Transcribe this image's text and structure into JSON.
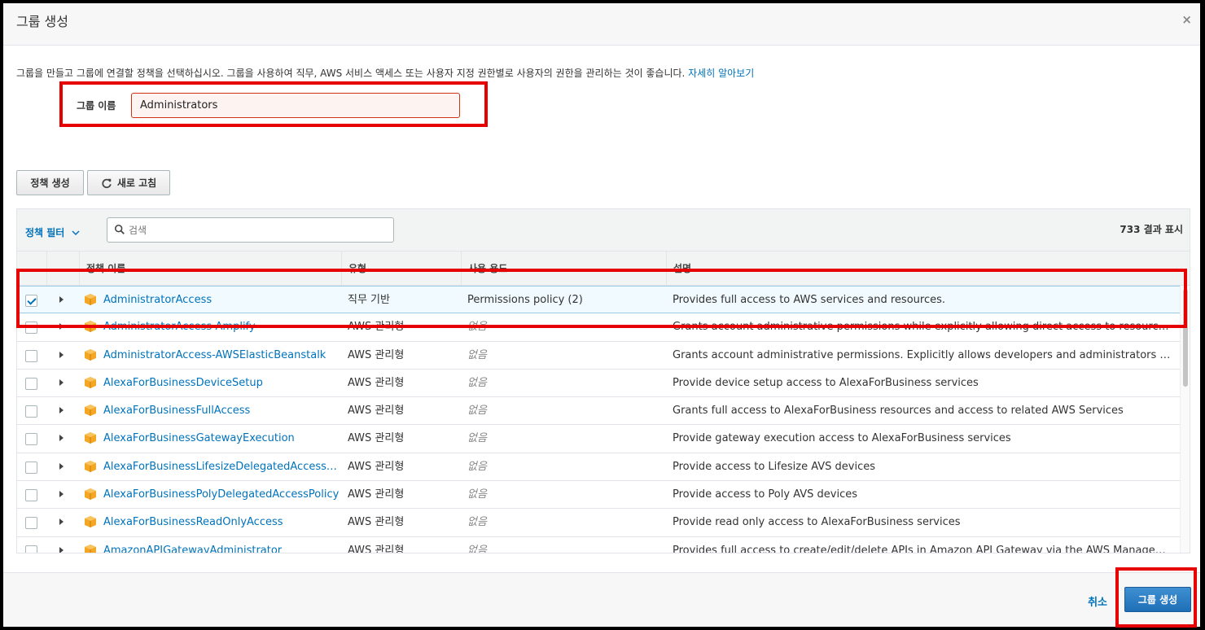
{
  "dialog": {
    "title": "그룹 생성",
    "close_symbol": "×",
    "description": "그룹을 만들고 그룹에 연결할 정책을 선택하십시오. 그룹을 사용하여 직무, AWS 서비스 액세스 또는 사용자 지정 권한별로 사용자의 권한을 관리하는 것이 좋습니다.",
    "learn_more": "자세히 알아보기"
  },
  "group_name": {
    "label": "그룹 이름",
    "value": "Administrators"
  },
  "toolbar": {
    "create_policy": "정책 생성",
    "refresh": "새로 고침"
  },
  "table": {
    "filter_label": "정책 필터",
    "search_placeholder": "검색",
    "result_count": "733 결과 표시",
    "columns": {
      "name": "정책 이름",
      "type": "유형",
      "usage": "사용 용도",
      "description": "설명"
    },
    "rows": [
      {
        "name": "AdministratorAccess",
        "type": "직무 기반",
        "usage": "Permissions policy (2)",
        "description": "Provides full access to AWS services and resources.",
        "checked": true
      },
      {
        "name": "AdministratorAccess-Amplify",
        "type": "AWS 관리형",
        "usage": "없음",
        "description": "Grants account administrative permissions while explicitly allowing direct access to resources needed by Amplify applications.",
        "checked": false
      },
      {
        "name": "AdministratorAccess-AWSElasticBeanstalk",
        "type": "AWS 관리형",
        "usage": "없음",
        "description": "Grants account administrative permissions. Explicitly allows developers and administrators to gain direct access to resources.",
        "checked": false
      },
      {
        "name": "AlexaForBusinessDeviceSetup",
        "type": "AWS 관리형",
        "usage": "없음",
        "description": "Provide device setup access to AlexaForBusiness services",
        "checked": false
      },
      {
        "name": "AlexaForBusinessFullAccess",
        "type": "AWS 관리형",
        "usage": "없음",
        "description": "Grants full access to AlexaForBusiness resources and access to related AWS Services",
        "checked": false
      },
      {
        "name": "AlexaForBusinessGatewayExecution",
        "type": "AWS 관리형",
        "usage": "없음",
        "description": "Provide gateway execution access to AlexaForBusiness services",
        "checked": false
      },
      {
        "name": "AlexaForBusinessLifesizeDelegatedAccessPolicy",
        "type": "AWS 관리형",
        "usage": "없음",
        "description": "Provide access to Lifesize AVS devices",
        "checked": false
      },
      {
        "name": "AlexaForBusinessPolyDelegatedAccessPolicy",
        "type": "AWS 관리형",
        "usage": "없음",
        "description": "Provide access to Poly AVS devices",
        "checked": false
      },
      {
        "name": "AlexaForBusinessReadOnlyAccess",
        "type": "AWS 관리형",
        "usage": "없음",
        "description": "Provide read only access to AlexaForBusiness services",
        "checked": false
      },
      {
        "name": "AmazonAPIGatewayAdministrator",
        "type": "AWS 관리형",
        "usage": "없음",
        "description": "Provides full access to create/edit/delete APIs in Amazon API Gateway via the AWS Management Console.",
        "checked": false
      }
    ]
  },
  "footer": {
    "cancel": "취소",
    "create_group": "그룹 생성"
  },
  "colors": {
    "link": "#0073bb",
    "primary_button": "#1f6fb8",
    "highlight_box": "#e60000",
    "policy_icon": "#f5a623"
  }
}
